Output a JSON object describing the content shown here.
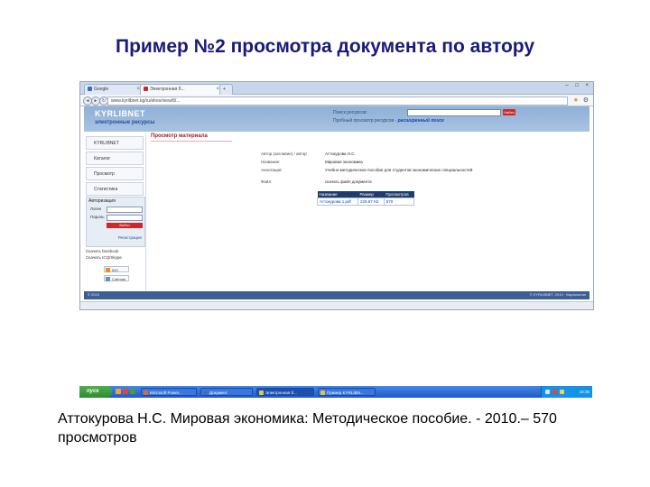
{
  "slide": {
    "title": "Пример №2 просмотра документа по автору",
    "caption": "Аттокурова Н.С. Мировая экономика: Методическое пособие. - 2010.– 570 просмотров"
  },
  "browser": {
    "tabs": [
      {
        "label": "Google"
      },
      {
        "label": "Электронная б...",
        "active": true
      },
      {
        "label": ""
      }
    ],
    "window_controls": "– □ ×",
    "url": "www.kyrlibnet.kg/ru/elres/view/8/...",
    "nav": {
      "back": "◄",
      "forward": "►",
      "reload": "↻"
    }
  },
  "site": {
    "logo": "KYRLIBNET",
    "logo_sub": "электронные ресурсы",
    "search_label": "Поиск ресурсов:",
    "search_button": "Найти",
    "advanced_prefix": "Пробный просмотр ресурсов -",
    "advanced_link": "расширенный поиск",
    "menu": [
      "KYRLIBNET",
      "Каталог",
      "Просмотр",
      "Статистика"
    ],
    "auth": {
      "title": "Авторизация",
      "login_label": "Логин",
      "password_label": "Пароль",
      "submit": "Войти",
      "register": "Регистрация"
    },
    "stats_lines": [
      "Скачать facebook",
      "Скачать ICQ/Skype"
    ],
    "counters": [
      "520",
      "Счётчик"
    ],
    "content": {
      "title": "Просмотр материала",
      "meta": [
        {
          "label": "Автор (заглавие) / автор",
          "value": "Аттокурова Н.С."
        },
        {
          "label": "Название:",
          "value": "Мировая экономика"
        },
        {
          "label": "Аннотация:",
          "value": "Учебно-методическое пособие для студентов экономических специальностей"
        },
        {
          "label": "Файл:",
          "value": "скачать файл документа"
        }
      ],
      "files_table": {
        "headers": [
          "Название",
          "Размер",
          "Просмотров"
        ],
        "rows": [
          [
            "Аттокурова 1.pdf",
            "226.87 Kb",
            "570"
          ]
        ]
      }
    },
    "footer_left": "© 2010",
    "footer_right": "© KYRLIBNET, 2010 · Кыргызстан"
  },
  "taskbar": {
    "start": "пуск",
    "tasks": [
      {
        "label": "Microsoft Power..."
      },
      {
        "label": "Документ"
      },
      {
        "label": "Электронная б..."
      },
      {
        "label": "Пример KYRLIBN..."
      }
    ],
    "clock": "10:35"
  },
  "colors": {
    "title": "#1a1a7a",
    "accent_red": "#cc2a2a",
    "header_blue": "#8fb0d6",
    "table_header": "#1e3d6e"
  }
}
